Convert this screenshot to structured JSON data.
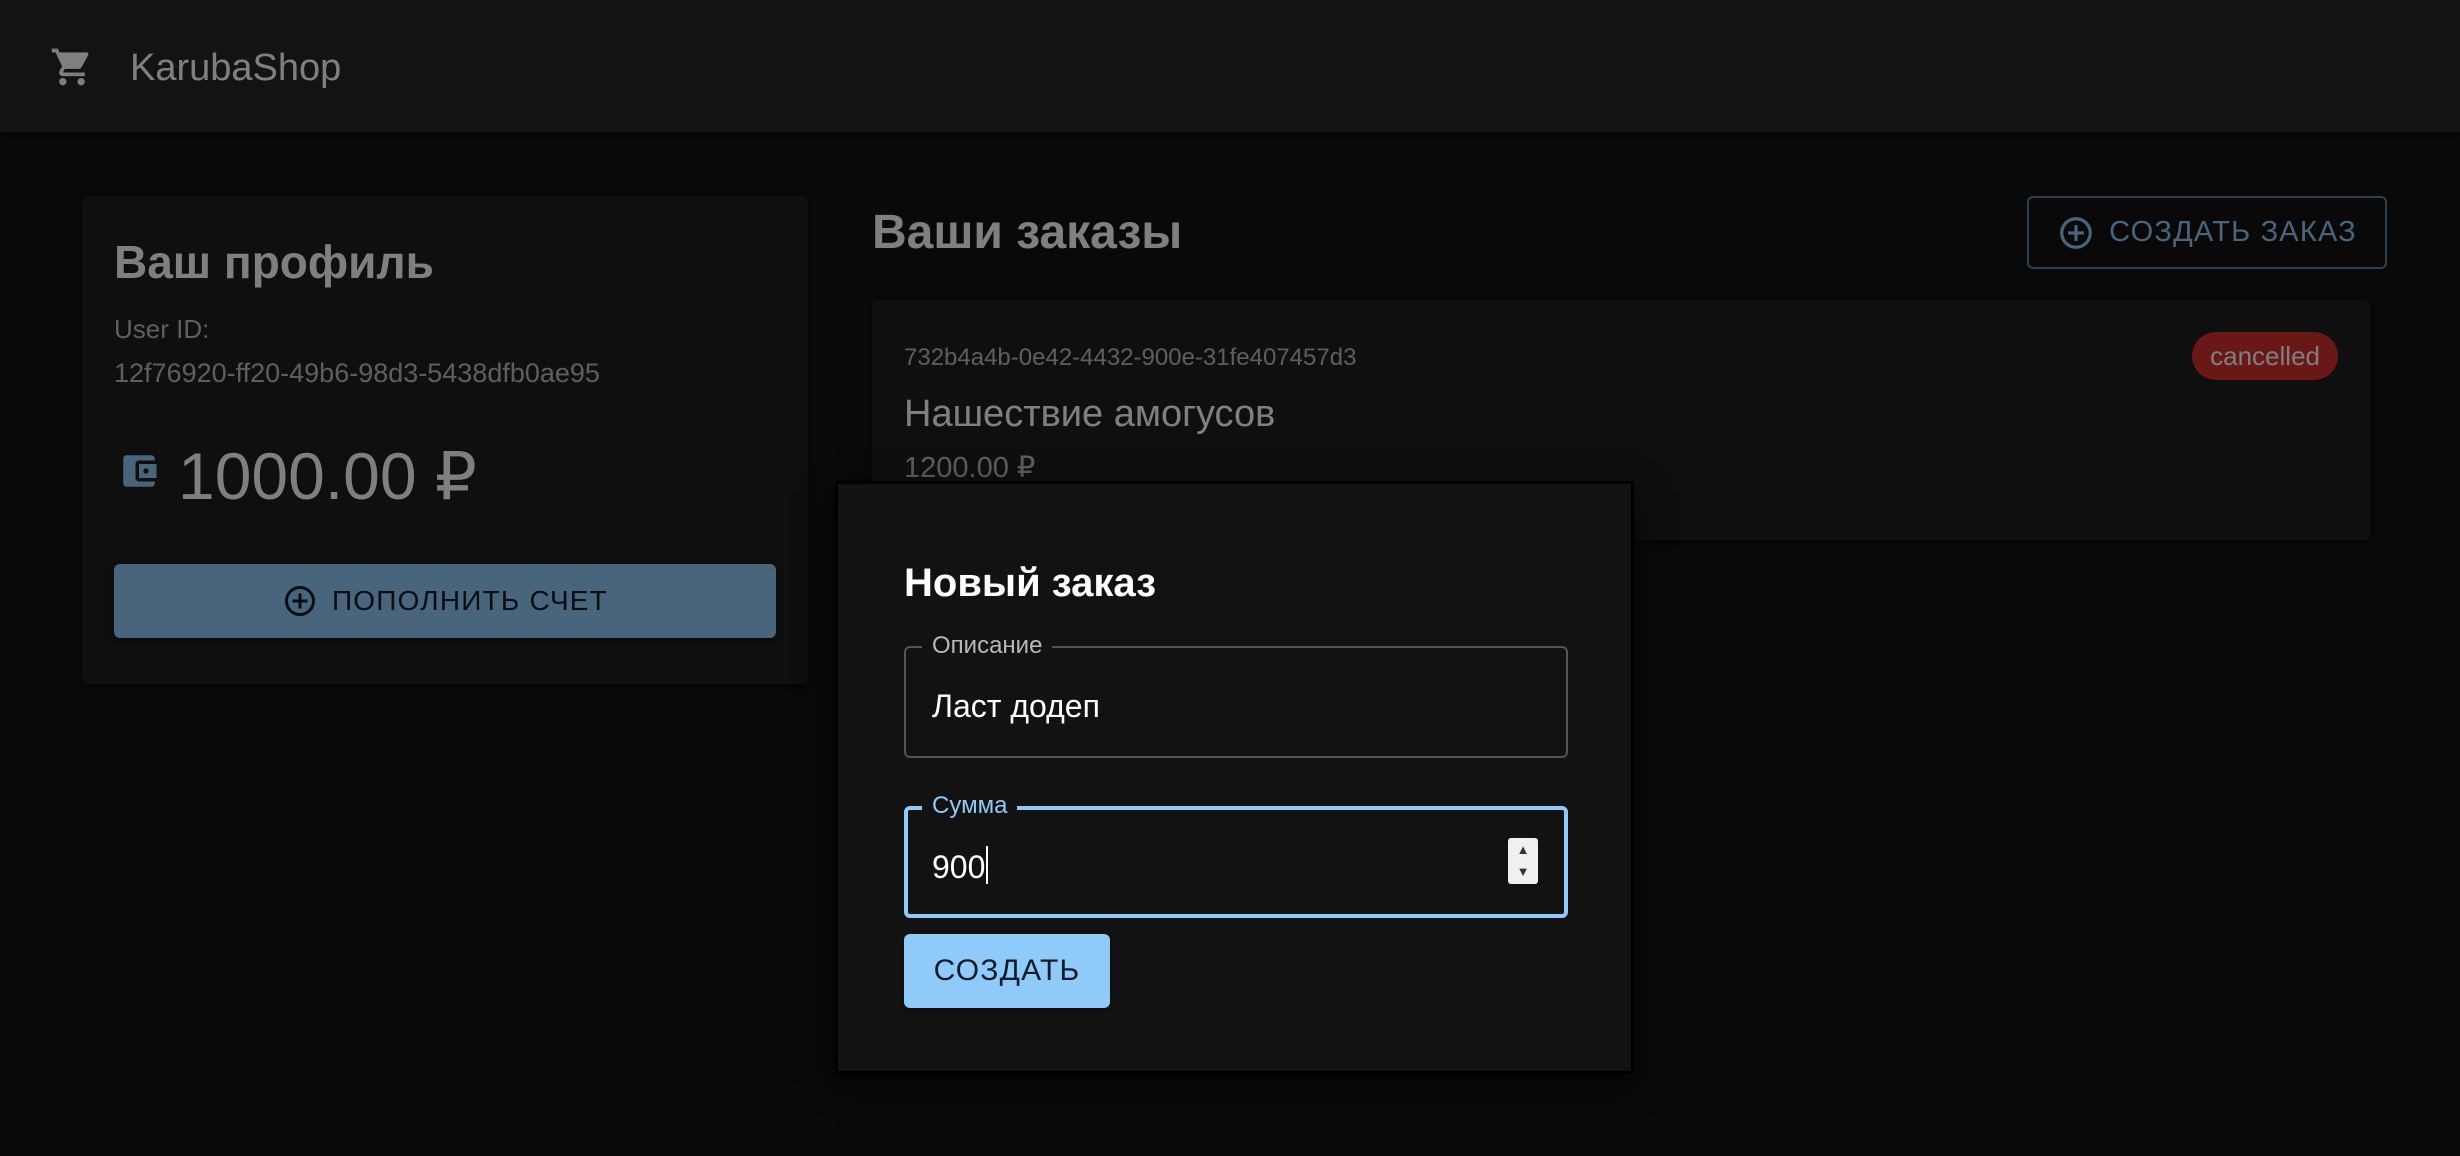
{
  "appbar": {
    "icon": "shopping-cart-icon",
    "brand": "KarubaShop"
  },
  "profile": {
    "title": "Ваш профиль",
    "user_id_label": "User ID:",
    "user_id": "12f76920-ff20-49b6-98d3-5438dfb0ae95",
    "wallet_icon": "wallet-icon",
    "balance": "1000.00 ₽",
    "topup_icon": "add-circle-icon",
    "topup_label": "ПОПОЛНИТЬ СЧЕТ"
  },
  "orders": {
    "title": "Ваши заказы",
    "create_icon": "add-circle-outline-icon",
    "create_label": "СОЗДАТЬ ЗАКАЗ",
    "items": [
      {
        "id": "732b4a4b-0e42-4432-900e-31fe407457d3",
        "description": "Нашествие амогусов",
        "amount": "1200.00 ₽",
        "status": "cancelled"
      }
    ]
  },
  "dialog": {
    "title": "Новый заказ",
    "description_label": "Описание",
    "description_value": "Ласт додеп",
    "amount_label": "Сумма",
    "amount_value": "900",
    "submit_label": "СОЗДАТЬ"
  },
  "colors": {
    "primary": "#90caf9",
    "error": "#d32f2f",
    "surface": "#1e1e1e",
    "background": "#121212"
  }
}
